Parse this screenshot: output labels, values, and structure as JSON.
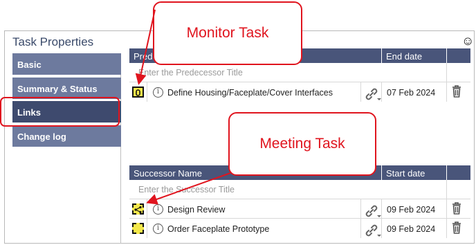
{
  "panel": {
    "title": "Task Properties",
    "smiley_icon": "smiley-icon"
  },
  "sidebar": {
    "items": [
      {
        "label": "Basic",
        "active": false
      },
      {
        "label": "Summary & Status",
        "active": false
      },
      {
        "label": "Links",
        "active": true
      },
      {
        "label": "Change log",
        "active": false
      }
    ]
  },
  "predecessors": {
    "header_name": "Prede",
    "header_date": "End date",
    "placeholder": "Enter the Predecessor Title",
    "rows": [
      {
        "type_icon": "monitor-task-icon",
        "name": "Define Housing/Faceplate/Cover Interfaces",
        "date": "07 Feb 2024"
      }
    ]
  },
  "successors": {
    "header_name": "Successor Name",
    "header_date": "Start date",
    "placeholder": "Enter the Successor Title",
    "rows": [
      {
        "type_icon": "meeting-task-icon",
        "name": "Design Review",
        "date": "09 Feb 2024"
      },
      {
        "type_icon": "task-icon",
        "name": "Order Faceplate Prototype",
        "date": "09 Feb 2024"
      }
    ]
  },
  "callouts": {
    "monitor": "Monitor Task",
    "meeting": "Meeting Task"
  },
  "colors": {
    "header": "#49557a",
    "nav": "#6d7a9e",
    "nav_active": "#3e4a6e",
    "accent": "#e0141e",
    "task_icon": "#f4e84a"
  }
}
